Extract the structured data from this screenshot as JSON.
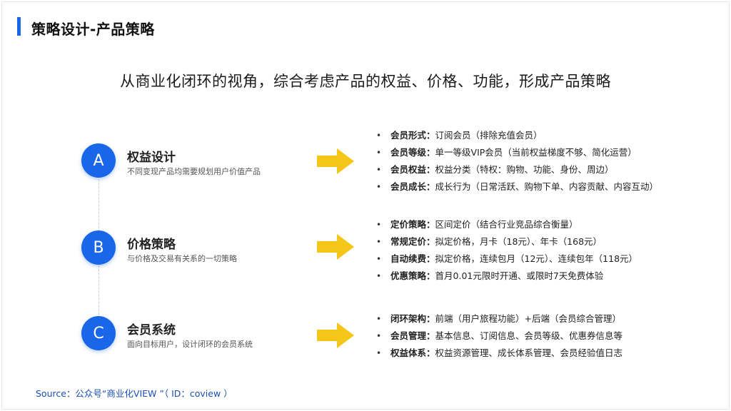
{
  "slide": {
    "title": "策略设计-产品策略",
    "subtitle": "从商业化闭环的视角，综合考虑产品的权益、价格、功能，形成产品策略",
    "source": "Source：公众号“商业化VIEW ”（ ID：coview ）"
  },
  "colors": {
    "accent": "#1a66e8",
    "arrow": "#f5c518"
  },
  "sections": [
    {
      "letter": "A",
      "heading": "权益设计",
      "description": "不同变现产品均需要规划用户价值产品",
      "bullets": [
        {
          "key": "会员形式：",
          "text": "订阅会员（排除充值会员）"
        },
        {
          "key": "会员等级：",
          "text": "单一等级VIP会员（当前权益梯度不够、简化运营）"
        },
        {
          "key": "会员权益：",
          "text": "权益分类（特权：购物、功能、身份、周边）"
        },
        {
          "key": "会员成长：",
          "text": "成长行为（日常活跃、购物下单、内容贡献、内容互动）"
        }
      ]
    },
    {
      "letter": "B",
      "heading": "价格策略",
      "description": "与价格及交易有关系的一切策略",
      "bullets": [
        {
          "key": "定价策略：",
          "text": "区间定价（结合行业竞品综合衡量）"
        },
        {
          "key": "常规定价：",
          "text": "拟定价格，月卡（18元）、年卡（168元）"
        },
        {
          "key": "自动续费：",
          "text": "拟定价格，连续包月（12元）、连续包年（118元）"
        },
        {
          "key": "优惠策略：",
          "text": "首月0.01元限时开通、或限时7天免费体验"
        }
      ]
    },
    {
      "letter": "C",
      "heading": "会员系统",
      "description": "面向目标用户，设计闭环的会员系统",
      "bullets": [
        {
          "key": "闭环架构：",
          "text": "前端（用户旅程功能）+后端（会员综合管理）"
        },
        {
          "key": "会员管理：",
          "text": "基本信息、订阅信息、会员等级、优惠券信息等"
        },
        {
          "key": "权益体系：",
          "text": "权益资源管理、成长体系管理、会员经验值日志"
        }
      ]
    }
  ]
}
